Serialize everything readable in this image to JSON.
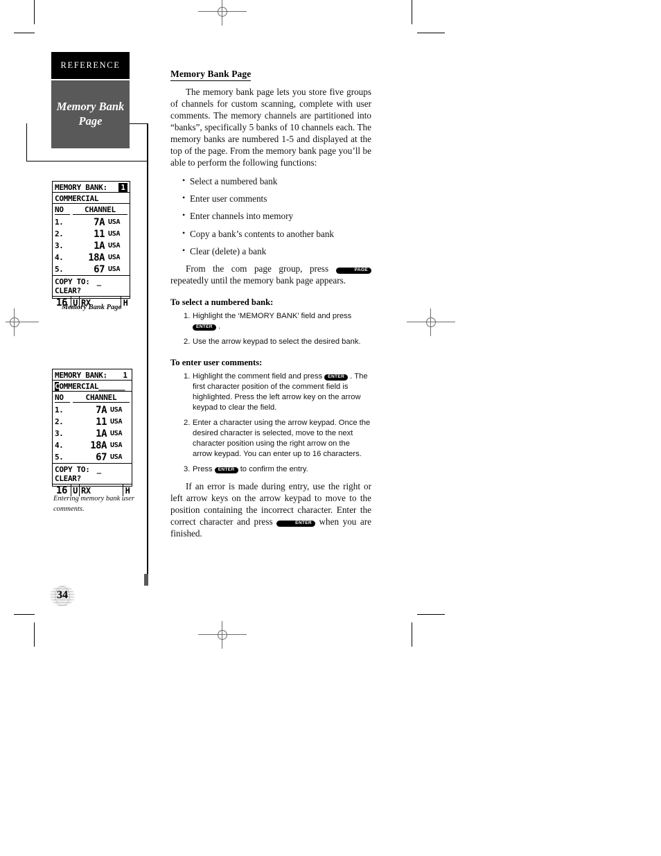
{
  "sidebar": {
    "reference_tab": "REFERENCE",
    "chapter_title_line1": "Memory Bank",
    "chapter_title_line2": "Page"
  },
  "figures": [
    {
      "name": "memory-bank-page",
      "caption": "Memory Bank Page",
      "screen": {
        "title_label": "MEMORY BANK:",
        "bank_number": "1",
        "bank_number_inverted": true,
        "comment": "COMMERCIAL",
        "comment_cursor_char": "",
        "comment_fill": "",
        "comment_cursor_active": false,
        "col_header_no": "NO",
        "col_header_channel": "CHANNEL",
        "channels": [
          {
            "index": "1.",
            "value": "7A",
            "region": "USA"
          },
          {
            "index": "2.",
            "value": "11",
            "region": "USA"
          },
          {
            "index": "3.",
            "value": "1A",
            "region": "USA"
          },
          {
            "index": "4.",
            "value": "18A",
            "region": "USA"
          },
          {
            "index": "5.",
            "value": "67",
            "region": "USA"
          }
        ],
        "copy_to_label": "COPY TO:",
        "copy_to_value": "_",
        "clear_label": "CLEAR?",
        "status_channel": "16",
        "status_mode": "U",
        "status_rx": "RX",
        "status_power": "H"
      }
    },
    {
      "name": "entering-user-comments",
      "caption": "Entering memory bank user comments.",
      "screen": {
        "title_label": "MEMORY BANK:",
        "bank_number": "1",
        "bank_number_inverted": false,
        "comment": "OMMERCIAL",
        "comment_cursor_char": "C",
        "comment_fill": "______",
        "comment_cursor_active": true,
        "col_header_no": "NO",
        "col_header_channel": "CHANNEL",
        "channels": [
          {
            "index": "1.",
            "value": "7A",
            "region": "USA"
          },
          {
            "index": "2.",
            "value": "11",
            "region": "USA"
          },
          {
            "index": "3.",
            "value": "1A",
            "region": "USA"
          },
          {
            "index": "4.",
            "value": "18A",
            "region": "USA"
          },
          {
            "index": "5.",
            "value": "67",
            "region": "USA"
          }
        ],
        "copy_to_label": "COPY TO:",
        "copy_to_value": "_",
        "clear_label": "CLEAR?",
        "status_channel": "16",
        "status_mode": "U",
        "status_rx": "RX",
        "status_power": "H"
      }
    }
  ],
  "main": {
    "heading": "Memory Bank Page",
    "intro": "The memory bank page lets you store five groups of channels for custom scanning, complete with user comments. The memory channels are partitioned into “banks”, specifically 5 banks of 10 channels each. The memory banks are numbered 1-5 and displayed at the top of the page. From the memory bank page you’ll be able to perform the following functions:",
    "bullets": [
      "Select a numbered bank",
      "Enter user comments",
      "Enter channels into memory",
      "Copy a bank’s contents to another bank",
      "Clear (delete) a bank"
    ],
    "access_text_before": "From the com page group, press",
    "access_key": "PAGE",
    "access_text_after": "repeatedly until the memory bank page appears.",
    "proc1": {
      "heading": "To select a numbered bank:",
      "steps": [
        {
          "num": "1.",
          "before": "Highlight the ‘MEMORY BANK’ field and press",
          "key": "ENTER",
          "after": "."
        },
        {
          "num": "2.",
          "before": "Use the arrow keypad to select the desired bank.",
          "key": "",
          "after": ""
        }
      ]
    },
    "proc2": {
      "heading": "To enter user comments:",
      "steps": [
        {
          "num": "1.",
          "before": "Highlight the comment field and press",
          "key": "ENTER",
          "after": ". The first character position of the comment field is highlighted. Press the left arrow key on the arrow keypad to clear the field."
        },
        {
          "num": "2.",
          "before": "Enter a character using the arrow keypad. Once the desired character is selected, move to the next character position using the right arrow on the arrow keypad. You can enter up to 16 characters.",
          "key": "",
          "after": ""
        },
        {
          "num": "3.",
          "before": "Press",
          "key": "ENTER",
          "after": "to confirm the entry."
        }
      ]
    },
    "closing_before": "If an error is made during entry, use the right or left arrow keys on the arrow keypad to move to the position containing the incorrect character. Enter the correct character and press",
    "closing_key": "ENTER",
    "closing_after": "when you are finished."
  },
  "page_number": "34"
}
